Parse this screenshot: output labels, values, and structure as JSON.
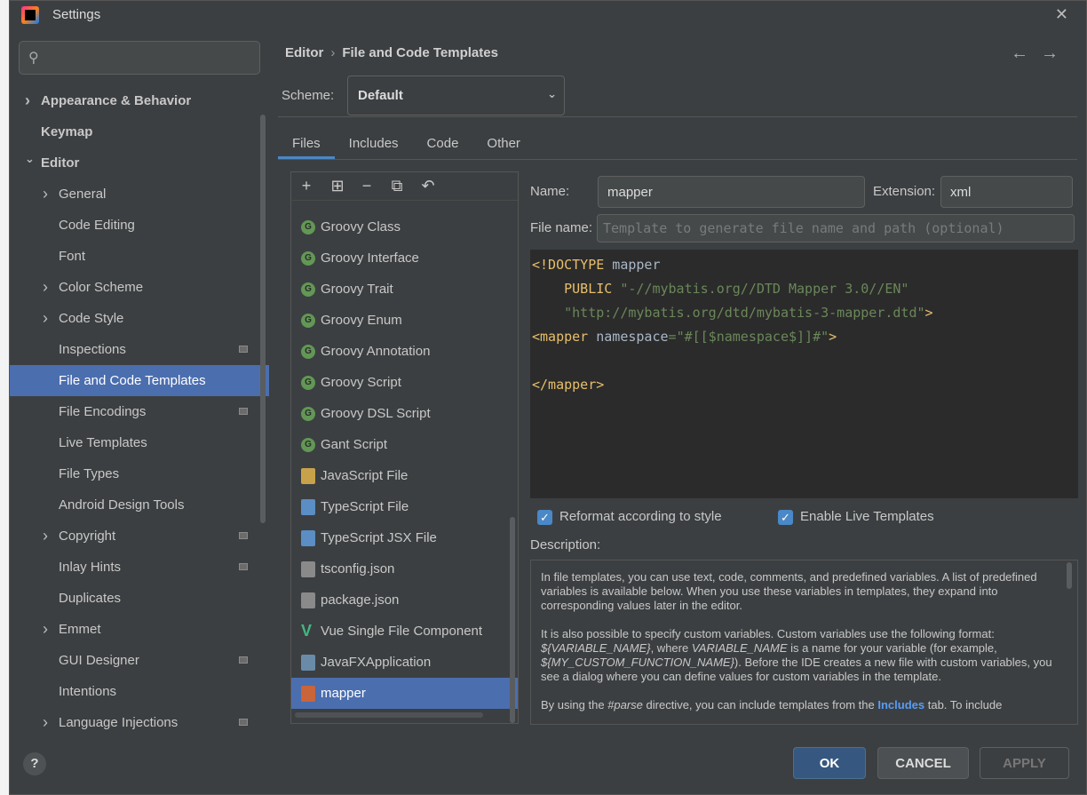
{
  "window": {
    "title": "Settings"
  },
  "search": {
    "placeholder": ""
  },
  "sidebar": {
    "items": [
      {
        "label": "Appearance & Behavior",
        "bold": true,
        "arrow": "right",
        "level": 0
      },
      {
        "label": "Keymap",
        "bold": true,
        "level": 0
      },
      {
        "label": "Editor",
        "bold": true,
        "arrow": "down",
        "level": 0
      },
      {
        "label": "General",
        "arrow": "right",
        "level": 1
      },
      {
        "label": "Code Editing",
        "level": 1
      },
      {
        "label": "Font",
        "level": 1
      },
      {
        "label": "Color Scheme",
        "arrow": "right",
        "level": 1
      },
      {
        "label": "Code Style",
        "arrow": "right",
        "level": 1
      },
      {
        "label": "Inspections",
        "level": 1,
        "project_icon": true
      },
      {
        "label": "File and Code Templates",
        "level": 1,
        "selected": true
      },
      {
        "label": "File Encodings",
        "level": 1,
        "project_icon": true
      },
      {
        "label": "Live Templates",
        "level": 1
      },
      {
        "label": "File Types",
        "level": 1
      },
      {
        "label": "Android Design Tools",
        "level": 1
      },
      {
        "label": "Copyright",
        "arrow": "right",
        "level": 1,
        "project_icon": true
      },
      {
        "label": "Inlay Hints",
        "level": 1,
        "project_icon": true
      },
      {
        "label": "Duplicates",
        "level": 1
      },
      {
        "label": "Emmet",
        "arrow": "right",
        "level": 1
      },
      {
        "label": "GUI Designer",
        "level": 1,
        "project_icon": true
      },
      {
        "label": "Intentions",
        "level": 1
      },
      {
        "label": "Language Injections",
        "arrow": "right",
        "level": 1,
        "project_icon": true
      }
    ]
  },
  "breadcrumb": {
    "parent": "Editor",
    "sep": "›",
    "current": "File and Code Templates"
  },
  "nav": {
    "back": "←",
    "forward": "→"
  },
  "scheme": {
    "label": "Scheme:",
    "value": "Default"
  },
  "tabs": [
    "Files",
    "Includes",
    "Code",
    "Other"
  ],
  "templates": {
    "items": [
      {
        "label": "Groovy Class",
        "icon": "groovy-icon"
      },
      {
        "label": "Groovy Interface",
        "icon": "groovy-icon"
      },
      {
        "label": "Groovy Trait",
        "icon": "groovy-icon"
      },
      {
        "label": "Groovy Enum",
        "icon": "groovy-icon"
      },
      {
        "label": "Groovy Annotation",
        "icon": "groovy-icon"
      },
      {
        "label": "Groovy Script",
        "icon": "groovy-icon"
      },
      {
        "label": "Groovy DSL Script",
        "icon": "groovy-icon"
      },
      {
        "label": "Gant Script",
        "icon": "groovy-icon"
      },
      {
        "label": "JavaScript File",
        "icon": "javascript-file-icon"
      },
      {
        "label": "TypeScript File",
        "icon": "typescript-file-icon"
      },
      {
        "label": "TypeScript JSX File",
        "icon": "tsx-file-icon"
      },
      {
        "label": "tsconfig.json",
        "icon": "json-file-icon"
      },
      {
        "label": "package.json",
        "icon": "json-file-icon"
      },
      {
        "label": "Vue Single File Component",
        "icon": "vue-icon"
      },
      {
        "label": "JavaFXApplication",
        "icon": "java-file-icon"
      },
      {
        "label": "mapper",
        "icon": "xml-file-icon",
        "selected": true
      }
    ]
  },
  "form": {
    "name_label": "Name:",
    "name_value": "mapper",
    "extension_label": "Extension:",
    "extension_value": "xml",
    "filename_label": "File name:",
    "filename_placeholder": "Template to generate file name and path (optional)"
  },
  "code": {
    "l1a": "<!DOCTYPE",
    "l1b": " mapper",
    "l2a": "    PUBLIC ",
    "l2b": "\"-//mybatis.org//DTD Mapper 3.0//EN\"",
    "l3a": "    ",
    "l3b": "\"http://mybatis.org/dtd/mybatis-3-mapper.dtd\"",
    "l3c": ">",
    "l4a": "<mapper",
    "l4b": " namespace",
    "l4c": "=",
    "l4d": "\"#[[$namespace$]]#\"",
    "l4e": ">",
    "l6": "</mapper>"
  },
  "options": {
    "reformat": "Reformat according to style",
    "live_templates": "Enable Live Templates"
  },
  "description": {
    "label": "Description:",
    "p1": "In file templates, you can use text, code, comments, and predefined variables. A list of predefined variables is available below. When you use these variables in templates, they expand into corresponding values later in the editor.",
    "p2a": "It is also possible to specify custom variables. Custom variables use the following format: ",
    "p2b": "${VARIABLE_NAME}",
    "p2c": ", where ",
    "p2d": "VARIABLE_NAME",
    "p2e": " is a name for your variable (for example, ",
    "p2f": "${MY_CUSTOM_FUNCTION_NAME}",
    "p2g": "). Before the IDE creates a new file with custom variables, you see a dialog where you can define values for custom variables in the template.",
    "p3a": "By using the ",
    "p3b": "#parse",
    "p3c": " directive, you can include templates from the ",
    "p3d": "Includes",
    "p3e": " tab. To include"
  },
  "footer": {
    "help": "?",
    "ok": "OK",
    "cancel": "CANCEL",
    "apply": "APPLY"
  },
  "colors": {
    "selection": "#4b6eaf",
    "accent": "#4a88c7",
    "background": "#3c3f41",
    "editor_bg": "#2b2b2b"
  }
}
